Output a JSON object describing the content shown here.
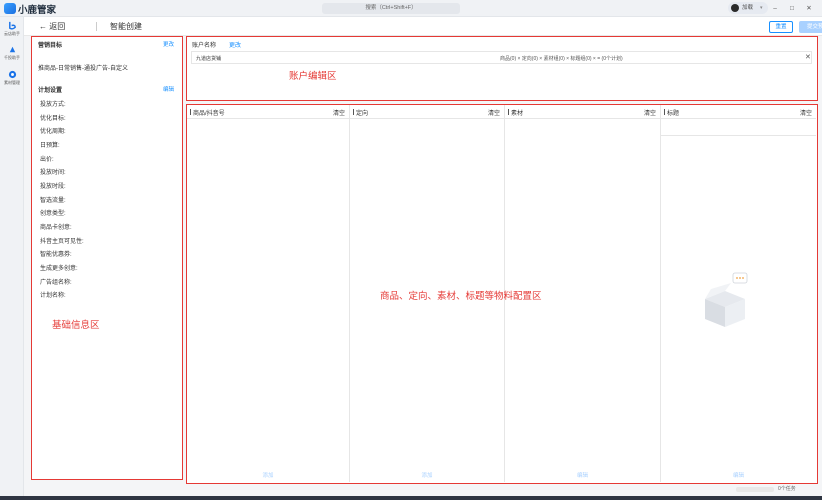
{
  "app": {
    "name": "小鹿管家"
  },
  "search": {
    "placeholder": "搜索（Ctrl+Shift+F）"
  },
  "user": {
    "name": "加载"
  },
  "window": {
    "minimize": "–",
    "restore": "□",
    "close": "✕"
  },
  "rail": {
    "items": [
      {
        "label": "云店助手",
        "icon": "bot-icon"
      },
      {
        "label": "千投助手",
        "icon": "rocket-icon"
      },
      {
        "label": "素材管理",
        "icon": "circle-icon"
      }
    ]
  },
  "topbar": {
    "back": "← 返回",
    "title": "智能创建",
    "reset": "重置",
    "publish": "提交预览"
  },
  "basic": {
    "goal_title": "营销目标",
    "goal_link": "更改",
    "goal_text": "推商品-日常销售-通投广告-自定义",
    "plan_title": "计划设置",
    "plan_link": "编辑",
    "fields": [
      "投放方式:",
      "优化目标:",
      "优化周期:",
      "日预算:",
      "出价:",
      "投放时间:",
      "投放时段:",
      "智选流量:",
      "创意类型:",
      "商品卡创意:",
      "抖音主页可见性:",
      "智能优惠券:",
      "生成更多创意:",
      "广告组名称:",
      "计划名称:"
    ],
    "zone_label": "基础信息区"
  },
  "account": {
    "label": "账户名称",
    "change": "更改",
    "row_name": "九道店货铺",
    "row_stats": "商品(0) × 定向(0) × 素材组(0) × 标题组(0) × = (0个计划)",
    "row_close": "✕",
    "zone_label": "账户编辑区"
  },
  "material": {
    "columns": [
      {
        "title": "商品/抖音号",
        "clear": "清空",
        "add": "添加"
      },
      {
        "title": "定向",
        "clear": "清空",
        "add": "添加"
      },
      {
        "title": "素材",
        "clear": "清空",
        "add": "编辑"
      },
      {
        "title": "标题",
        "clear": "清空",
        "add": "编辑"
      }
    ],
    "zone_label": "商品、定向、素材、标题等物料配置区"
  },
  "status": {
    "text": "0个任务"
  },
  "colors": {
    "accent": "#1890ff",
    "annotation": "#e53935",
    "disabled_accent": "#a9d1ff"
  }
}
